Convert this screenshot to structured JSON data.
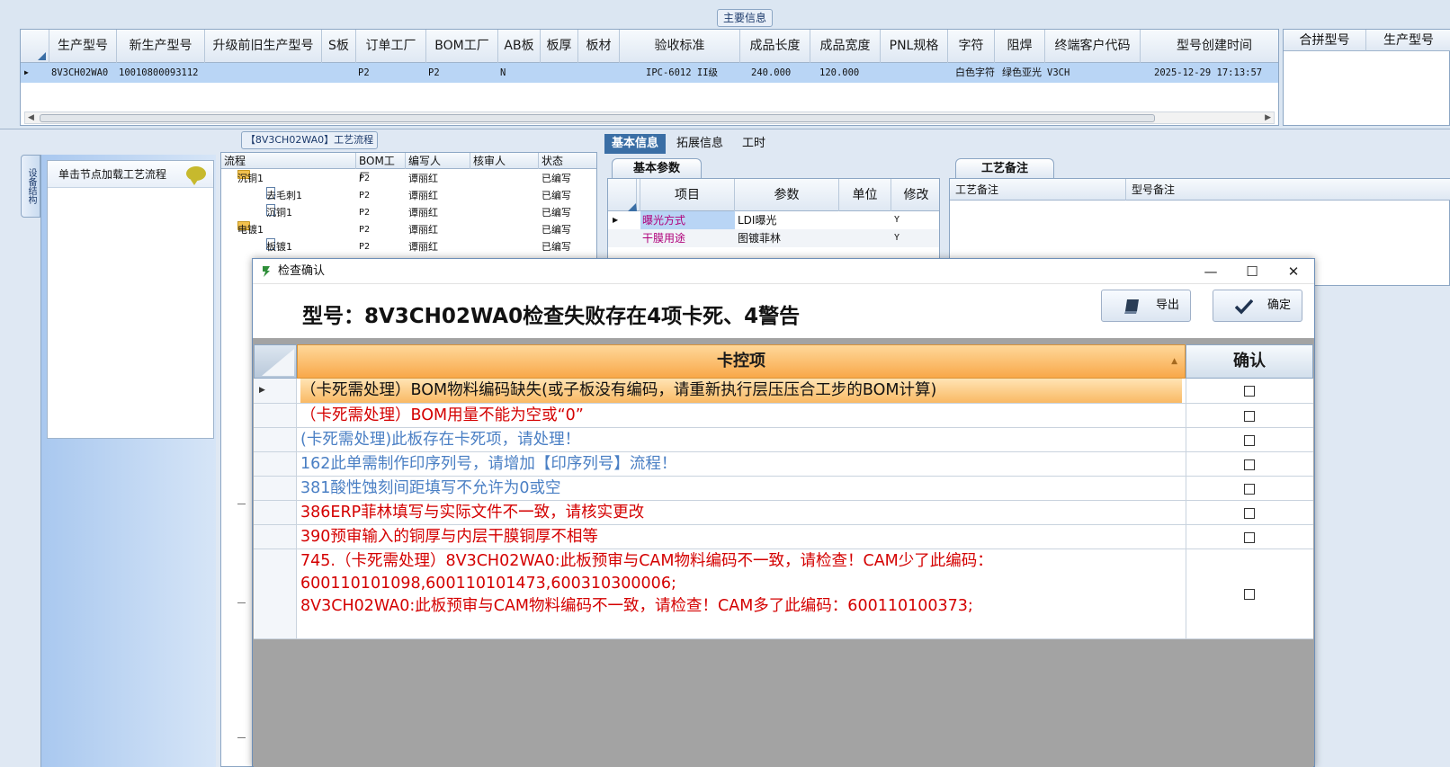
{
  "main_info": {
    "title": "主要信息",
    "columns": [
      "生产型号",
      "新生产型号",
      "升级前旧生产型号",
      "S板",
      "订单工厂",
      "BOM工厂",
      "AB板",
      "板厚",
      "板材",
      "验收标准",
      "成品长度",
      "成品宽度",
      "PNL规格",
      "字符",
      "阻焊",
      "终端客户代码",
      "型号创建时间"
    ],
    "row": {
      "model": "8V3CH02WA0",
      "new_model": "10010800093112",
      "order_factory": "P2",
      "bom_factory": "P2",
      "ab_board": "N",
      "acceptance": "IPC-6012 II级",
      "length": "240.000",
      "width": "120.000",
      "char": "白色字符",
      "solder_mask": "绿色亚光",
      "customer_code": "V3CH",
      "created": "2025-12-29 17:13:57"
    }
  },
  "merge_panel": {
    "columns": [
      "合拼型号",
      "生产型号"
    ]
  },
  "side": {
    "vtab": "设备结构",
    "hint": "单击节点加载工艺流程"
  },
  "flow": {
    "title": "【8V3CH02WA0】工艺流程",
    "columns": [
      "流程",
      "BOM工厂",
      "编写人",
      "核审人",
      "状态"
    ],
    "rows": [
      {
        "name": "沉铜1",
        "factory": "P2",
        "writer": "谭丽红",
        "status": "已编写",
        "type": "folder"
      },
      {
        "name": "去毛刺1",
        "factory": "P2",
        "writer": "谭丽红",
        "status": "已编写",
        "type": "doc"
      },
      {
        "name": "沉铜1",
        "factory": "P2",
        "writer": "谭丽红",
        "status": "已编写",
        "type": "doc"
      },
      {
        "name": "电镀1",
        "factory": "P2",
        "writer": "谭丽红",
        "status": "已编写",
        "type": "folder"
      },
      {
        "name": "板镀1",
        "factory": "P2",
        "writer": "谭丽红",
        "status": "已编写",
        "type": "doc"
      }
    ]
  },
  "right_tabs": [
    "基本信息",
    "拓展信息",
    "工时"
  ],
  "basic_params": {
    "tab": "基本参数",
    "columns": [
      "项目",
      "参数",
      "单位",
      "修改"
    ],
    "rows": [
      {
        "item": "曝光方式",
        "value": "LDI曝光",
        "unit": "",
        "edit": "Y"
      },
      {
        "item": "干膜用途",
        "value": "图镀菲林",
        "unit": "",
        "edit": "Y"
      }
    ]
  },
  "remarks": {
    "tab": "工艺备注",
    "columns": [
      "工艺备注",
      "型号备注"
    ]
  },
  "dialog": {
    "title": "检查确认",
    "headline": "型号：8V3CH02WA0检查失败存在4项卡死、4警告",
    "export_label": "导出",
    "confirm_label": "确定",
    "col_item": "卡控项",
    "col_confirm": "确认",
    "items": [
      {
        "text": "（卡死需处理）BOM物料编码缺失(或子板没有编码，请重新执行层压压合工步的BOM计算)",
        "color": "#1a1a1a"
      },
      {
        "text": "（卡死需处理）BOM用量不能为空或“0”",
        "color": "#d40000"
      },
      {
        "text": "(卡死需处理)此板存在卡死项，请处理！",
        "color": "#4a7fc4"
      },
      {
        "text": "162此单需制作印序列号，请增加【印序列号】流程！",
        "color": "#4a7fc4"
      },
      {
        "text": "381酸性蚀刻间距填写不允许为0或空",
        "color": "#4a7fc4"
      },
      {
        "text": "386ERP菲林填写与实际文件不一致，请核实更改",
        "color": "#d40000"
      },
      {
        "text": "390预审输入的铜厚与内层干膜铜厚不相等",
        "color": "#d40000"
      }
    ],
    "multi_item": {
      "line1": "745.（卡死需处理）8V3CH02WA0:此板预审与CAM物料编码不一致，请检查！CAM少了此编码：",
      "line2": "600110101098,600110101473,600310300006;",
      "line3": "8V3CH02WA0:此板预审与CAM物料编码不一致，请检查！CAM多了此编码：600110100373;",
      "color": "#d40000"
    }
  }
}
